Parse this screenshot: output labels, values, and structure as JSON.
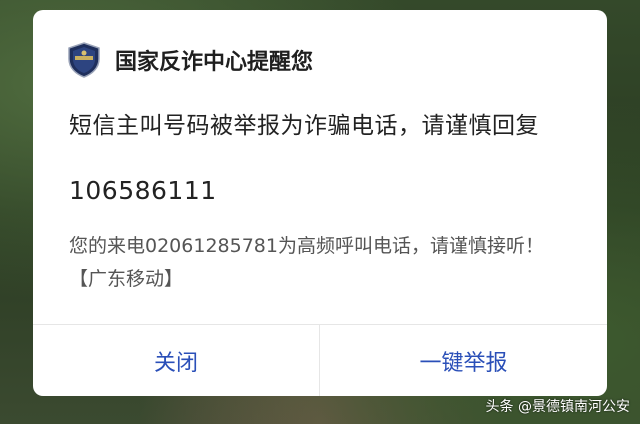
{
  "dialog": {
    "title": "国家反诈中心提醒您",
    "sender_warning": "短信主叫号码被举报为诈骗电话，请谨慎回复",
    "sender_number": "106586111",
    "message": "您的来电02061285781为高频呼叫电话，请谨慎接听！【广东移动】",
    "buttons": {
      "close_label": "关闭",
      "report_label": "一键举报"
    },
    "icon": "shield-icon",
    "accent_color": "#2a4fb8"
  },
  "watermark": {
    "text": "头条 @景德镇南河公安"
  }
}
